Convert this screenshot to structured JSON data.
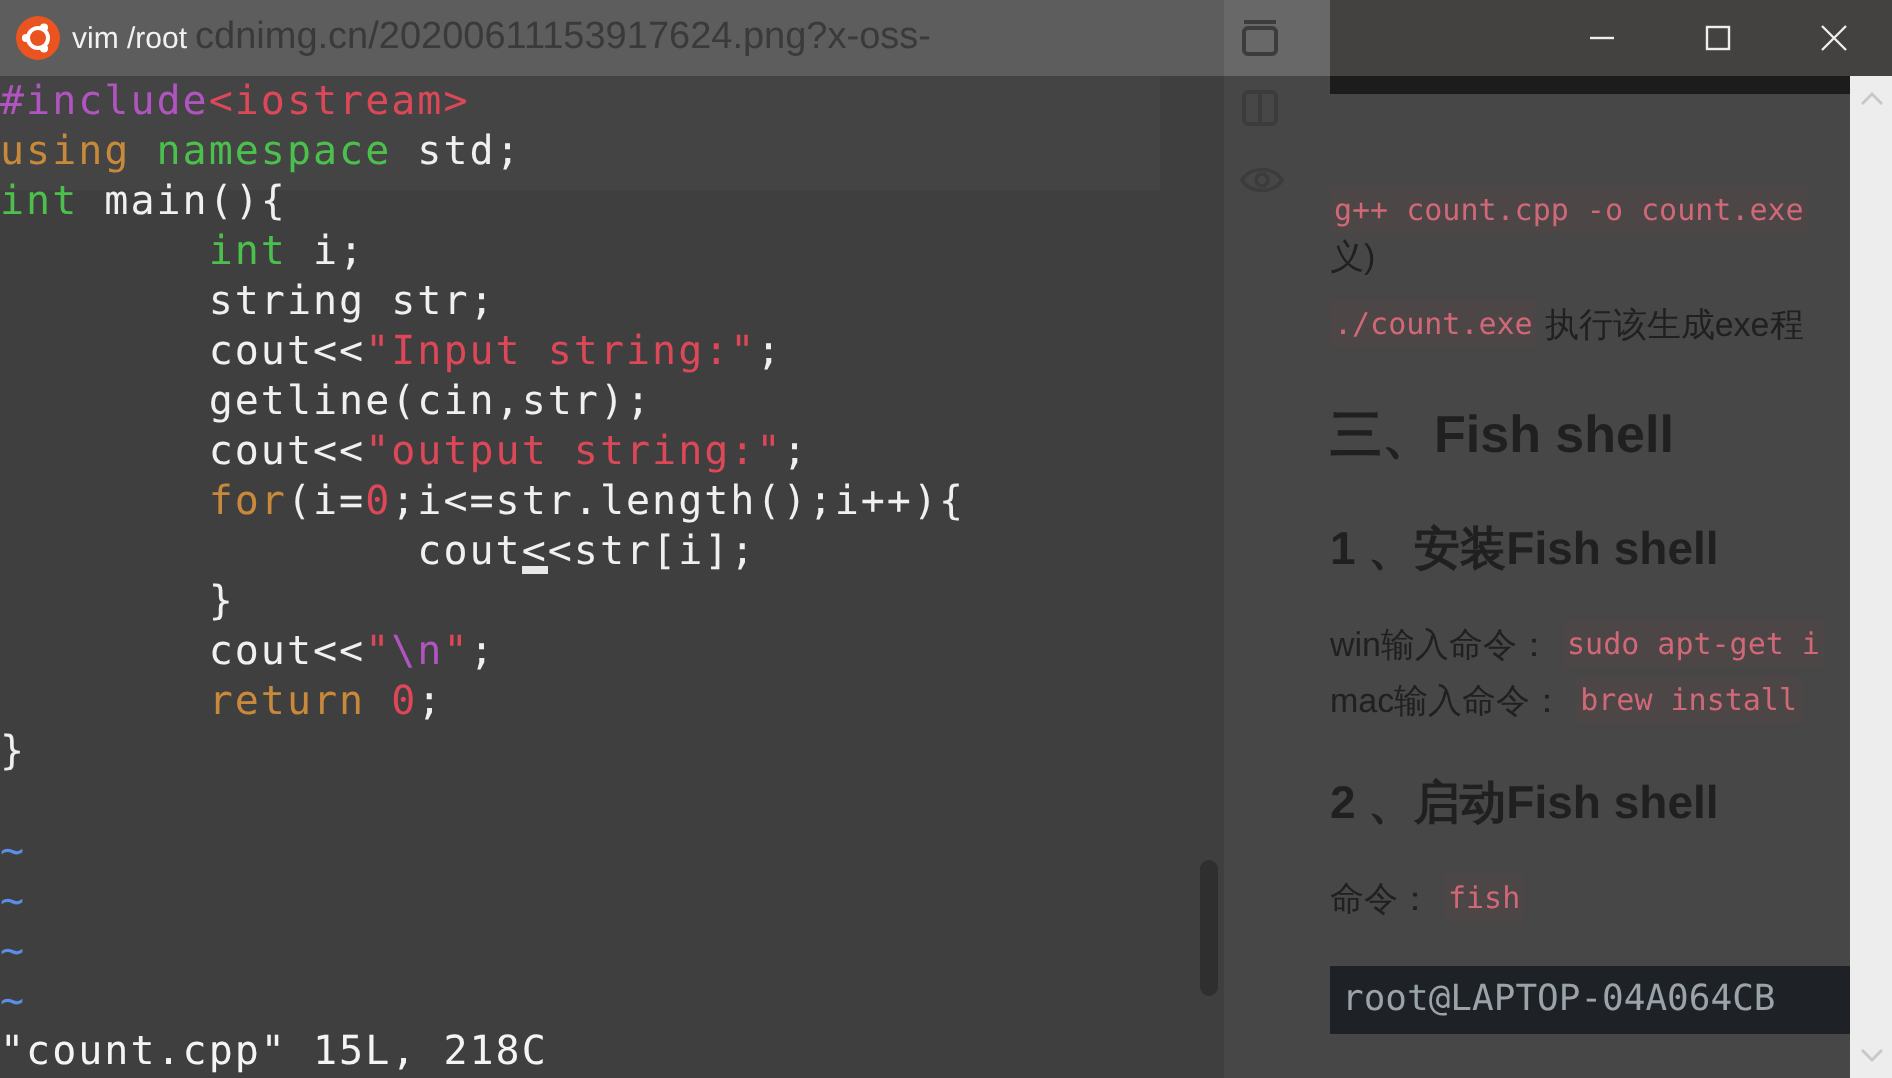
{
  "window": {
    "title": "vim /root"
  },
  "background_page": {
    "url_text": "cdnimg.cn/20200611153917624.png?x-oss-"
  },
  "editor": {
    "lines": [
      {
        "segments": [
          {
            "kind": "preproc",
            "text": "#include"
          },
          {
            "kind": "string",
            "text": "<iostream>"
          }
        ]
      },
      {
        "segments": [
          {
            "kind": "statement",
            "text": "using"
          },
          {
            "kind": "type",
            "text": " namespace"
          },
          {
            "kind": "plain",
            "text": " std;"
          }
        ]
      },
      {
        "segments": [
          {
            "kind": "type",
            "text": "int"
          },
          {
            "kind": "plain",
            "text": " main(){"
          }
        ]
      },
      {
        "segments": [
          {
            "kind": "type",
            "text": "        int"
          },
          {
            "kind": "plain",
            "text": " i;"
          }
        ]
      },
      {
        "segments": [
          {
            "kind": "plain",
            "text": "        string str;"
          }
        ]
      },
      {
        "segments": [
          {
            "kind": "plain",
            "text": "        cout<<"
          },
          {
            "kind": "string",
            "text": "\"Input string:\""
          },
          {
            "kind": "plain",
            "text": ";"
          }
        ]
      },
      {
        "segments": [
          {
            "kind": "plain",
            "text": "        getline(cin,str);"
          }
        ]
      },
      {
        "segments": [
          {
            "kind": "plain",
            "text": "        cout<<"
          },
          {
            "kind": "string",
            "text": "\"output string:\""
          },
          {
            "kind": "plain",
            "text": ";"
          }
        ]
      },
      {
        "segments": [
          {
            "kind": "statement",
            "text": "        for"
          },
          {
            "kind": "plain",
            "text": "(i="
          },
          {
            "kind": "number",
            "text": "0"
          },
          {
            "kind": "plain",
            "text": ";i<=str.length();i++){"
          }
        ]
      },
      {
        "segments": [
          {
            "kind": "plain",
            "text": "                cout"
          },
          {
            "kind": "cursor",
            "text": "<"
          },
          {
            "kind": "plain",
            "text": "<str[i];"
          }
        ]
      },
      {
        "segments": [
          {
            "kind": "plain",
            "text": "        }"
          }
        ]
      },
      {
        "segments": [
          {
            "kind": "plain",
            "text": "        cout<<"
          },
          {
            "kind": "string",
            "text": "\""
          },
          {
            "kind": "special",
            "text": "\\n"
          },
          {
            "kind": "string",
            "text": "\""
          },
          {
            "kind": "plain",
            "text": ";"
          }
        ]
      },
      {
        "segments": [
          {
            "kind": "statement",
            "text": "        return"
          },
          {
            "kind": "number",
            "text": " 0"
          },
          {
            "kind": "plain",
            "text": ";"
          }
        ]
      },
      {
        "segments": [
          {
            "kind": "plain",
            "text": "}"
          }
        ]
      }
    ],
    "tildes": [
      "~",
      "~",
      "~",
      "~"
    ],
    "status": "\"count.cpp\" 15L, 218C"
  },
  "article": [
    {
      "kind": "code_line",
      "code": "g++ count.cpp -o count.exe"
    },
    {
      "kind": "text",
      "text": "义)"
    },
    {
      "kind": "code_text",
      "code": "./count.exe",
      "text": "执行该生成exe程"
    },
    {
      "kind": "h2",
      "text": "三、Fish shell"
    },
    {
      "kind": "h3",
      "text": "1 、安装Fish shell"
    },
    {
      "kind": "label_code",
      "text": "win输入命令：",
      "code": "sudo apt-get i"
    },
    {
      "kind": "label_code",
      "text": "mac输入命令：",
      "code": "brew install"
    },
    {
      "kind": "h3",
      "text": "2 、启动Fish shell"
    },
    {
      "kind": "label_code",
      "text": "命令：",
      "code": "fish"
    },
    {
      "kind": "terminal",
      "text": "root@LAPTOP-04A064CB"
    }
  ]
}
